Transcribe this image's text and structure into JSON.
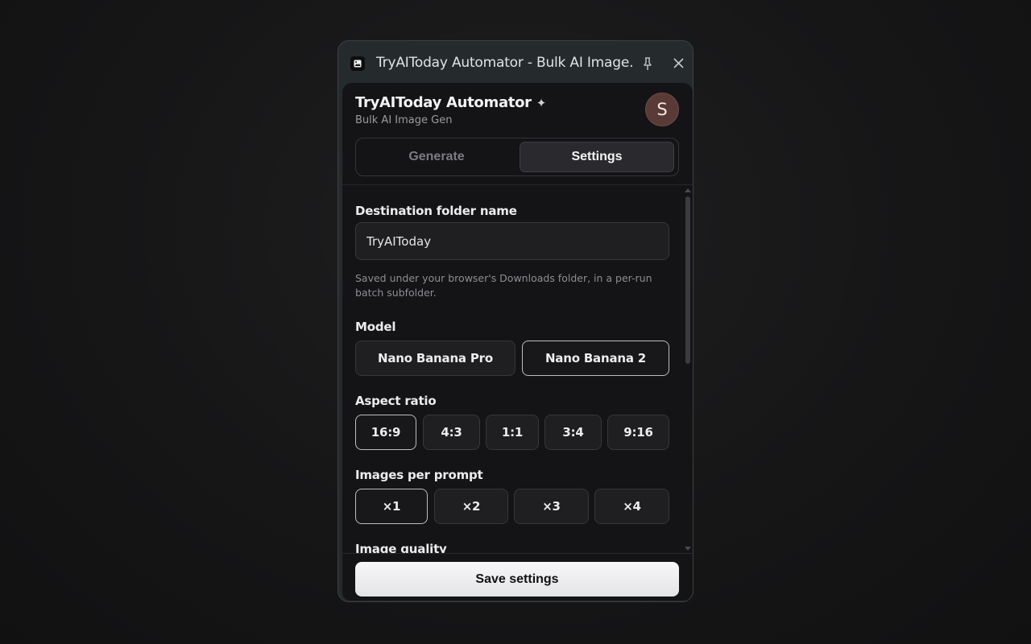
{
  "window": {
    "title": "TryAIToday Automator - Bulk AI Image..."
  },
  "header": {
    "title": "TryAIToday Automator",
    "sparkle": "✦",
    "subtitle": "Bulk AI Image Gen",
    "avatar_initial": "S"
  },
  "tabs": [
    {
      "label": "Generate",
      "active": false
    },
    {
      "label": "Settings",
      "active": true
    }
  ],
  "settings": {
    "destination": {
      "label": "Destination folder name",
      "value": "TryAIToday",
      "helper": "Saved under your browser's Downloads folder, in a per-run batch subfolder."
    },
    "model": {
      "label": "Model",
      "options": [
        "Nano Banana Pro",
        "Nano Banana 2"
      ],
      "selected": "Nano Banana 2"
    },
    "aspect_ratio": {
      "label": "Aspect ratio",
      "options": [
        "16:9",
        "4:3",
        "1:1",
        "3:4",
        "9:16"
      ],
      "selected": "16:9"
    },
    "images_per_prompt": {
      "label": "Images per prompt",
      "options": [
        "×1",
        "×2",
        "×3",
        "×4"
      ],
      "selected": "×1"
    },
    "image_quality": {
      "label": "Image quality"
    }
  },
  "footer": {
    "save_label": "Save settings"
  },
  "colors": {
    "panel_bg": "#141416",
    "titlebar_bg": "#252b2d",
    "avatar_bg": "#5a3a36",
    "selected_border": "#bdbdc2",
    "save_bg": "#f2f2f4"
  }
}
